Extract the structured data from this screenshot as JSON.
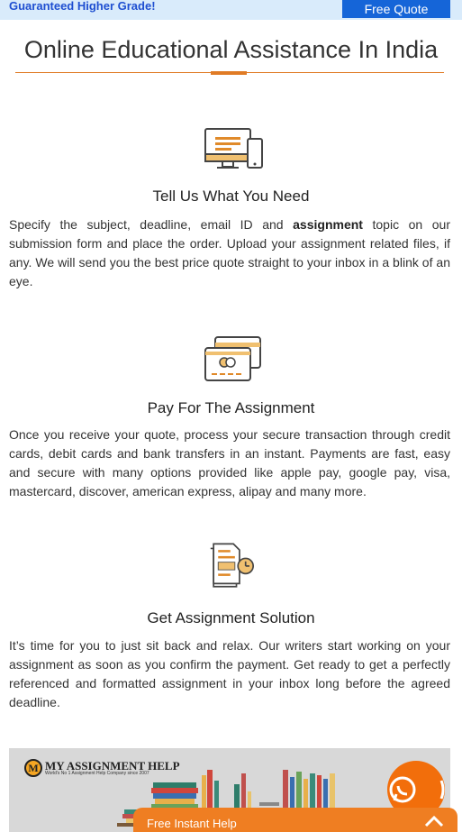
{
  "topbar": {
    "tagline": "Guaranteed Higher Grade!",
    "quote_button": "Free Quote"
  },
  "page_title": "Online Educational Assistance In India",
  "steps": [
    {
      "icon": "monitor-document-icon",
      "title": "Tell Us What You Need",
      "text_before": "Specify the subject, deadline, email ID and ",
      "text_bold": "assignment",
      "text_after": " topic on our submission form and place the order. Upload your assignment related files, if any. We will send you the best price quote straight to your inbox in a blink of an eye."
    },
    {
      "icon": "credit-card-icon",
      "title": "Pay For The Assignment",
      "text": "Once you receive your quote, process your secure transaction through credit cards, debit cards and bank transfers in an instant. Payments are fast, easy and secure with many options provided like apple pay, google pay, visa, mastercard, discover, american express, alipay and many more."
    },
    {
      "icon": "document-clock-icon",
      "title": "Get Assignment Solution",
      "text": "It’s time for you to just sit back and relax. Our writers start working on your assignment as soon as you confirm the payment. Get ready to get a perfectly referenced and formatted assignment in your inbox long before the agreed deadline."
    }
  ],
  "banner": {
    "logo_letter": "M",
    "brand": "MY ASSIGNMENT HELP",
    "tagline": "World's No 1 Assignment Help Company since 2007"
  },
  "whatsapp": {
    "icon": "whatsapp-icon"
  },
  "help_bar": {
    "label": "Free Instant Help",
    "icon": "chevron-up-icon"
  },
  "colors": {
    "accent": "#ef7e22",
    "topbar_bg": "#d9ebfb",
    "quote_button_bg": "#1565d8",
    "tagline": "#1f4fd1"
  }
}
